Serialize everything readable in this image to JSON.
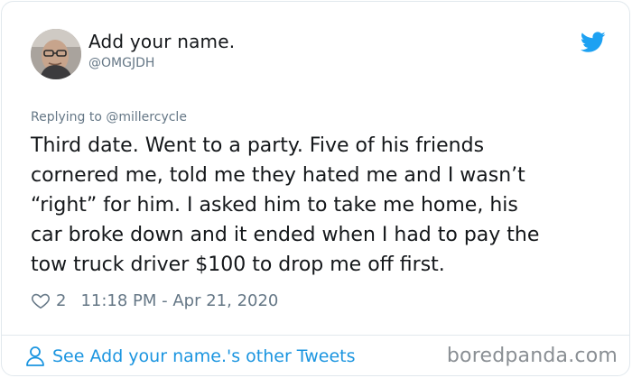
{
  "tweet": {
    "author": {
      "display_name": "Add your name.",
      "handle": "@OMGJDH"
    },
    "replying_to": "Replying to @millercycle",
    "text_lines": [
      "Third date. Went to a party.  Five of his friends",
      "cornered me, told me they hated me and I wasn’t",
      "“right” for him.  I asked him to take me home, his",
      "car broke down and it ended when I had to pay the",
      "tow truck driver $100 to drop me off first."
    ],
    "like_count": "2",
    "timestamp": "11:18 PM - Apr 21, 2020"
  },
  "footer": {
    "see_more_label": "See Add your name.'s other Tweets"
  },
  "watermark": "boredpanda.com",
  "colors": {
    "accent": "#1b95e0",
    "text": "#14171a",
    "muted": "#657786",
    "border": "#e1e8ed"
  },
  "icons": {
    "brand": "twitter-bird-icon",
    "like": "heart-icon",
    "profile": "person-icon"
  }
}
